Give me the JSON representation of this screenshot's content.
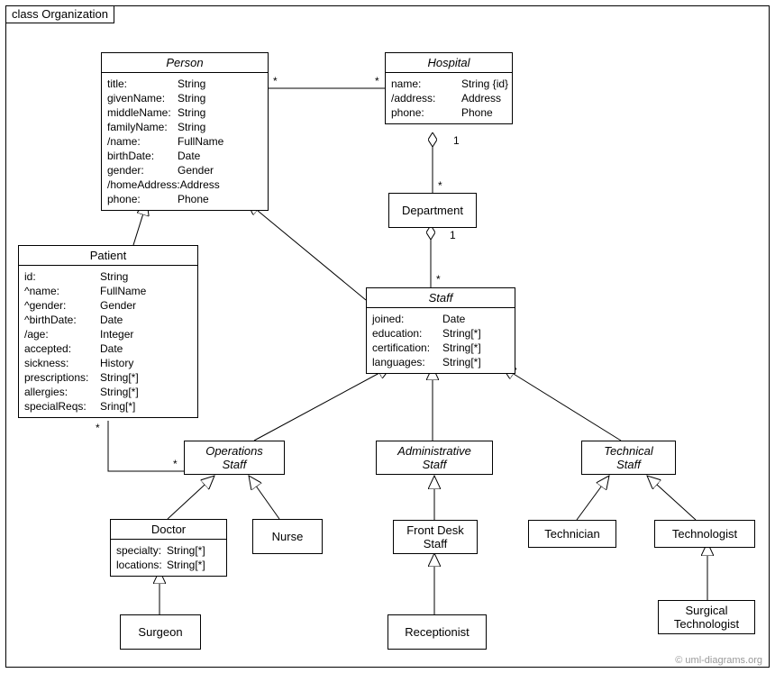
{
  "diagram": {
    "title": "class Organization",
    "watermark": "© uml-diagrams.org"
  },
  "classes": {
    "person": {
      "name": "Person",
      "attrs": [
        {
          "k": "title:",
          "v": "String"
        },
        {
          "k": "givenName:",
          "v": "String"
        },
        {
          "k": "middleName:",
          "v": "String"
        },
        {
          "k": "familyName:",
          "v": "String"
        },
        {
          "k": "/name:",
          "v": "FullName"
        },
        {
          "k": "birthDate:",
          "v": "Date"
        },
        {
          "k": "gender:",
          "v": "Gender"
        },
        {
          "k": "/homeAddress:",
          "v": "Address"
        },
        {
          "k": "phone:",
          "v": "Phone"
        }
      ]
    },
    "hospital": {
      "name": "Hospital",
      "attrs": [
        {
          "k": "name:",
          "v": "String {id}"
        },
        {
          "k": "/address:",
          "v": "Address"
        },
        {
          "k": "phone:",
          "v": "Phone"
        }
      ]
    },
    "department": {
      "name": "Department"
    },
    "staff": {
      "name": "Staff",
      "attrs": [
        {
          "k": "joined:",
          "v": "Date"
        },
        {
          "k": "education:",
          "v": "String[*]"
        },
        {
          "k": "certification:",
          "v": "String[*]"
        },
        {
          "k": "languages:",
          "v": "String[*]"
        }
      ]
    },
    "patient": {
      "name": "Patient",
      "attrs": [
        {
          "k": "id:",
          "v": "String"
        },
        {
          "k": "^name:",
          "v": "FullName"
        },
        {
          "k": "^gender:",
          "v": "Gender"
        },
        {
          "k": "^birthDate:",
          "v": "Date"
        },
        {
          "k": "/age:",
          "v": "Integer"
        },
        {
          "k": "accepted:",
          "v": "Date"
        },
        {
          "k": "sickness:",
          "v": "History"
        },
        {
          "k": "prescriptions:",
          "v": "String[*]"
        },
        {
          "k": "allergies:",
          "v": "String[*]"
        },
        {
          "k": "specialReqs:",
          "v": "Sring[*]"
        }
      ]
    },
    "opsStaff": {
      "name1": "Operations",
      "name2": "Staff"
    },
    "adminStaff": {
      "name1": "Administrative",
      "name2": "Staff"
    },
    "techStaff": {
      "name1": "Technical",
      "name2": "Staff"
    },
    "doctor": {
      "name": "Doctor",
      "attrs": [
        {
          "k": "specialty:",
          "v": "String[*]"
        },
        {
          "k": "locations:",
          "v": "String[*]"
        }
      ]
    },
    "nurse": {
      "name": "Nurse"
    },
    "frontDesk": {
      "name1": "Front Desk",
      "name2": "Staff"
    },
    "technician": {
      "name": "Technician"
    },
    "technologist": {
      "name": "Technologist"
    },
    "surgeon": {
      "name": "Surgeon"
    },
    "receptionist": {
      "name": "Receptionist"
    },
    "surgTech": {
      "name1": "Surgical",
      "name2": "Technologist"
    }
  },
  "mult": {
    "personStar": "*",
    "hospStar": "*",
    "hospDep1": "1",
    "depStar": "*",
    "depStaff1": "1",
    "staffStar": "*",
    "patStar": "*",
    "opsStar": "*"
  }
}
